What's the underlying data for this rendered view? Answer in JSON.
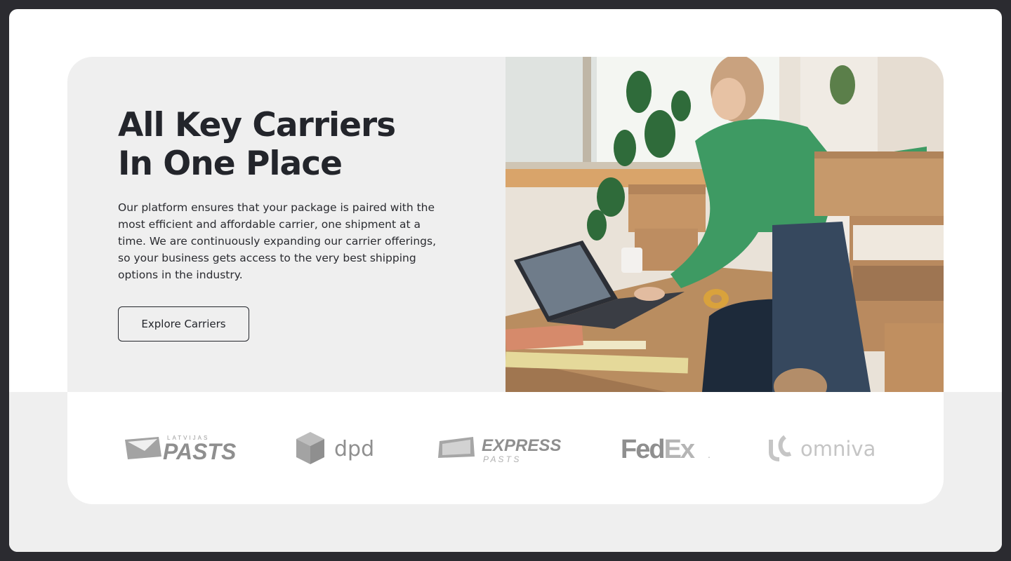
{
  "hero": {
    "title_line1": "All Key Carriers",
    "title_line2": "In One Place",
    "description": "Our platform ensures that your package is paired with the most efficient and affordable carrier, one shipment at a time. We are continuously expanding our carrier offerings, so your business gets access to the very best shipping options in the industry.",
    "cta_label": "Explore Carriers"
  },
  "carriers": [
    {
      "name": "Latvijas Pasts",
      "top_text": "LATVIJAS",
      "main_text": "PASTS",
      "icon": "envelope-icon"
    },
    {
      "name": "DPD",
      "main_text": "dpd",
      "icon": "cube-icon"
    },
    {
      "name": "Express Pasts",
      "main_text": "EXPRESS",
      "sub_text": "P A S T S",
      "icon": "envelope-icon"
    },
    {
      "name": "FedEx",
      "main_text_a": "Fed",
      "main_text_b": "Ex",
      "mark": "."
    },
    {
      "name": "Omniva",
      "main_text": "omniva",
      "icon": "omniva-mark-icon"
    }
  ],
  "colors": {
    "page_bg": "#2b2b30",
    "panel_bg": "#efefef",
    "heading": "#23252b",
    "logo_gray": "#8a8a8a"
  }
}
